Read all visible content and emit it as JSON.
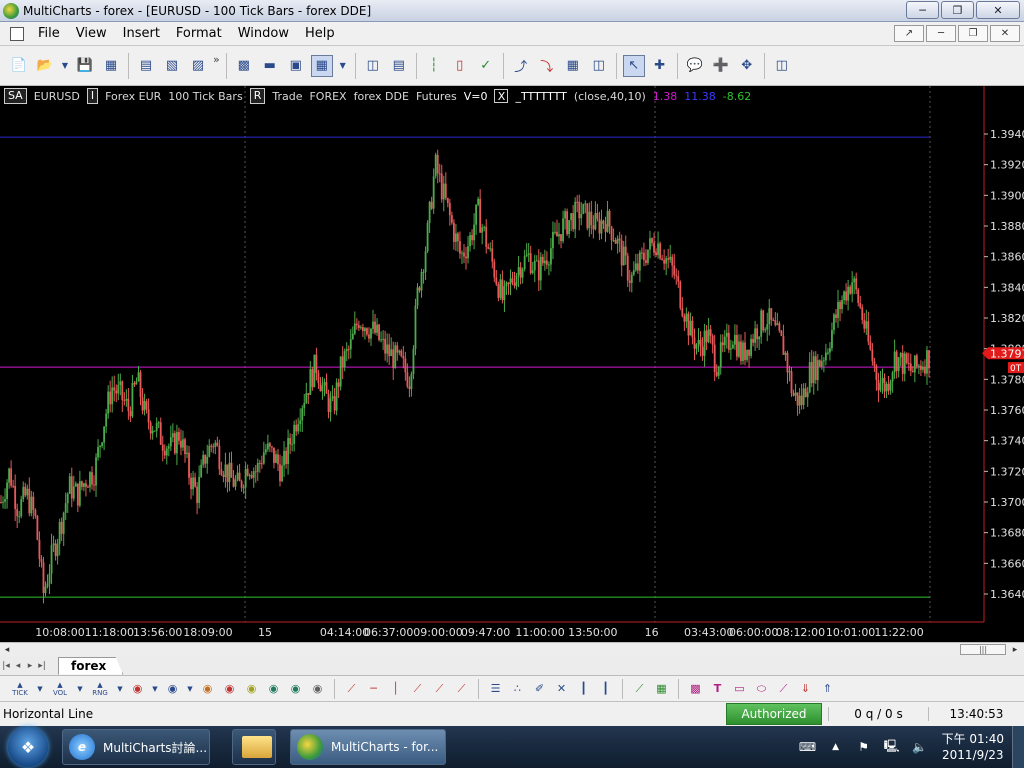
{
  "window": {
    "title": "MultiCharts - forex - [EURUSD - 100 Tick Bars - forex DDE]",
    "min_icon": "minimize-icon",
    "max_icon": "restore-icon",
    "close_icon": "close-icon"
  },
  "menu": {
    "items": [
      "File",
      "View",
      "Insert",
      "Format",
      "Window",
      "Help"
    ]
  },
  "toolbar": {
    "overflow": "»"
  },
  "chart_status": {
    "sa": "SA",
    "symbol": "EURUSD",
    "i_box": "I",
    "desc": "Forex EUR",
    "resolution": "100 Tick Bars",
    "r_box": "R",
    "data_type": "Trade",
    "exchange": "FOREX",
    "feed": "forex DDE",
    "category": "Futures",
    "volume": "V=0",
    "x_box": "X",
    "indicator": "_TTTTTTT",
    "indicator_params": "(close,40,10)",
    "val1": "1.38",
    "val2": "11.38",
    "val3": "-8.62"
  },
  "colors": {
    "bg": "#000000",
    "up_bar": "#4cab4c",
    "down_bar": "#e85a5a",
    "top_line": "#2a2ad8",
    "mid_line": "#d01ad0",
    "bottom_line": "#2ec22e",
    "price_marker": "#e21a1a"
  },
  "chart_data": {
    "type": "candlestick",
    "ylim": [
      1.362,
      1.396
    ],
    "price_ticks": [
      "1.3940",
      "1.3920",
      "1.3900",
      "1.3880",
      "1.3860",
      "1.3840",
      "1.3820",
      "1.3800",
      "1.3780",
      "1.3760",
      "1.3740",
      "1.3720",
      "1.3700",
      "1.3680",
      "1.3660",
      "1.3640"
    ],
    "time_ticks": [
      "10:08:00",
      "11:18:00",
      "13:56:00",
      "18:09:00",
      "15",
      "04:14:00",
      "06:37:00",
      "09:00:00",
      "09:47:00",
      "11:00:00",
      "13:50:00",
      "16",
      "03:43:00",
      "06:00:00",
      "08:12:00",
      "10:01:00",
      "11:22:00"
    ],
    "current_price": "1.3797",
    "marker_label": "0T",
    "horizontal_lines": [
      1.3938,
      1.3788,
      1.3638
    ],
    "close_path": [
      1.37,
      1.372,
      1.3695,
      1.3705,
      1.369,
      1.364,
      1.3665,
      1.3685,
      1.371,
      1.3705,
      1.3715,
      1.372,
      1.375,
      1.3775,
      1.377,
      1.376,
      1.378,
      1.3755,
      1.375,
      1.374,
      1.3735,
      1.3745,
      1.372,
      1.3705,
      1.373,
      1.374,
      1.3725,
      1.3715,
      1.371,
      1.3725,
      1.372,
      1.3735,
      1.373,
      1.372,
      1.374,
      1.376,
      1.3775,
      1.379,
      1.377,
      1.376,
      1.379,
      1.38,
      1.382,
      1.3815,
      1.381,
      1.38,
      1.3795,
      1.379,
      1.378,
      1.384,
      1.387,
      1.392,
      1.39,
      1.388,
      1.386,
      1.387,
      1.389,
      1.387,
      1.385,
      1.383,
      1.3845,
      1.3855,
      1.386,
      1.385,
      1.386,
      1.387,
      1.388,
      1.3885,
      1.389,
      1.3885,
      1.388,
      1.3885,
      1.3875,
      1.386,
      1.3845,
      1.3855,
      1.3865,
      1.387,
      1.386,
      1.385,
      1.383,
      1.381,
      1.38,
      1.381,
      1.379,
      1.38,
      1.381,
      1.3795,
      1.3805,
      1.3815,
      1.382,
      1.381,
      1.38,
      1.377,
      1.3765,
      1.3785,
      1.379,
      1.38,
      1.382,
      1.3835,
      1.3845,
      1.3825,
      1.38,
      1.378,
      1.3775,
      1.3795,
      1.379,
      1.3785,
      1.379,
      1.3795
    ]
  },
  "scroll": {
    "left_arrow": "◂",
    "right_arrow": "▸",
    "thumb": "|||"
  },
  "tabs": {
    "nav": [
      "|◂",
      "◂",
      "▸",
      "▸|"
    ],
    "items": [
      "forex"
    ]
  },
  "drawbar": {
    "labels": [
      "TICK",
      "VOL",
      "RNG"
    ]
  },
  "statusbar": {
    "tool": "Horizontal Line",
    "auth": "Authorized",
    "queue": "0 q / 0 s",
    "time": "13:40:53"
  },
  "taskbar": {
    "tasks": [
      {
        "label": "MultiCharts討論...",
        "icon": "ie-icon"
      },
      {
        "label": "",
        "icon": "folder-icon"
      },
      {
        "label": "MultiCharts - for...",
        "icon": "multicharts-icon"
      }
    ],
    "clock_time": "下午 01:40",
    "clock_date": "2011/9/23"
  }
}
